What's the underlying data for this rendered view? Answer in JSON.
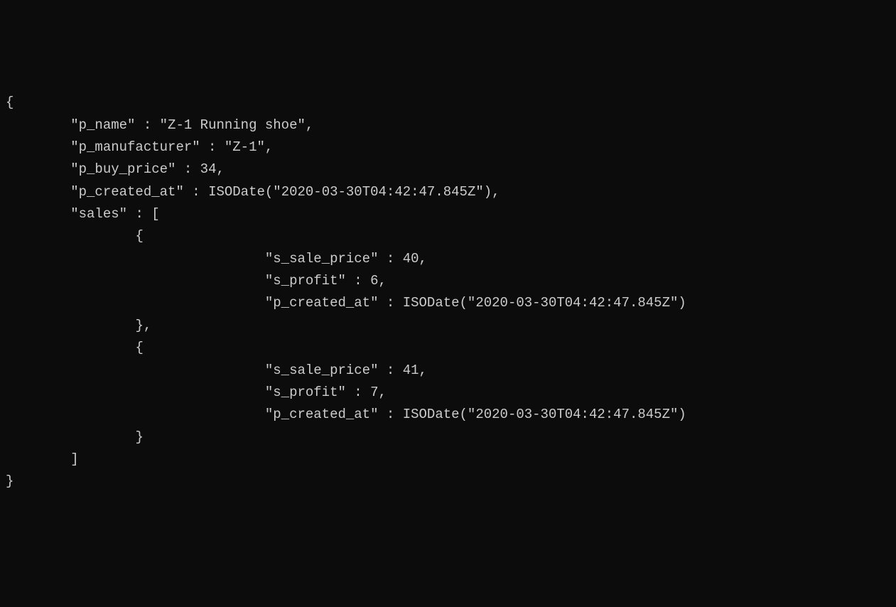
{
  "code": {
    "line1": "{",
    "line2_key": "\"p_name\"",
    "line2_sep": " : ",
    "line2_val": "\"Z-1 Running shoe\"",
    "line2_end": ",",
    "line3_key": "\"p_manufacturer\"",
    "line3_sep": " : ",
    "line3_val": "\"Z-1\"",
    "line3_end": ",",
    "line4_key": "\"p_buy_price\"",
    "line4_sep": " : ",
    "line4_val": "34",
    "line4_end": ",",
    "line5_key": "\"p_created_at\"",
    "line5_sep": " : ",
    "line5_val": "ISODate(\"2020-03-30T04:42:47.845Z\")",
    "line5_end": ",",
    "line6_key": "\"sales\"",
    "line6_sep": " : ",
    "line6_val": "[",
    "line7": "{",
    "line8_key": "\"s_sale_price\"",
    "line8_sep": " : ",
    "line8_val": "40",
    "line8_end": ",",
    "line9_key": "\"s_profit\"",
    "line9_sep": " : ",
    "line9_val": "6",
    "line9_end": ",",
    "line10_key": "\"p_created_at\"",
    "line10_sep": " : ",
    "line10_val": "ISODate(\"2020-03-30T04:42:47.845Z\")",
    "line11": "},",
    "line12": "{",
    "line13_key": "\"s_sale_price\"",
    "line13_sep": " : ",
    "line13_val": "41",
    "line13_end": ",",
    "line14_key": "\"s_profit\"",
    "line14_sep": " : ",
    "line14_val": "7",
    "line14_end": ",",
    "line15_key": "\"p_created_at\"",
    "line15_sep": " : ",
    "line15_val": "ISODate(\"2020-03-30T04:42:47.845Z\")",
    "line16": "}",
    "line17": "]",
    "line18": "}"
  },
  "indent": {
    "i0": "",
    "i1": "        ",
    "i2": "                ",
    "i3": "                                ",
    "close2": "                ",
    "close1": "        "
  }
}
